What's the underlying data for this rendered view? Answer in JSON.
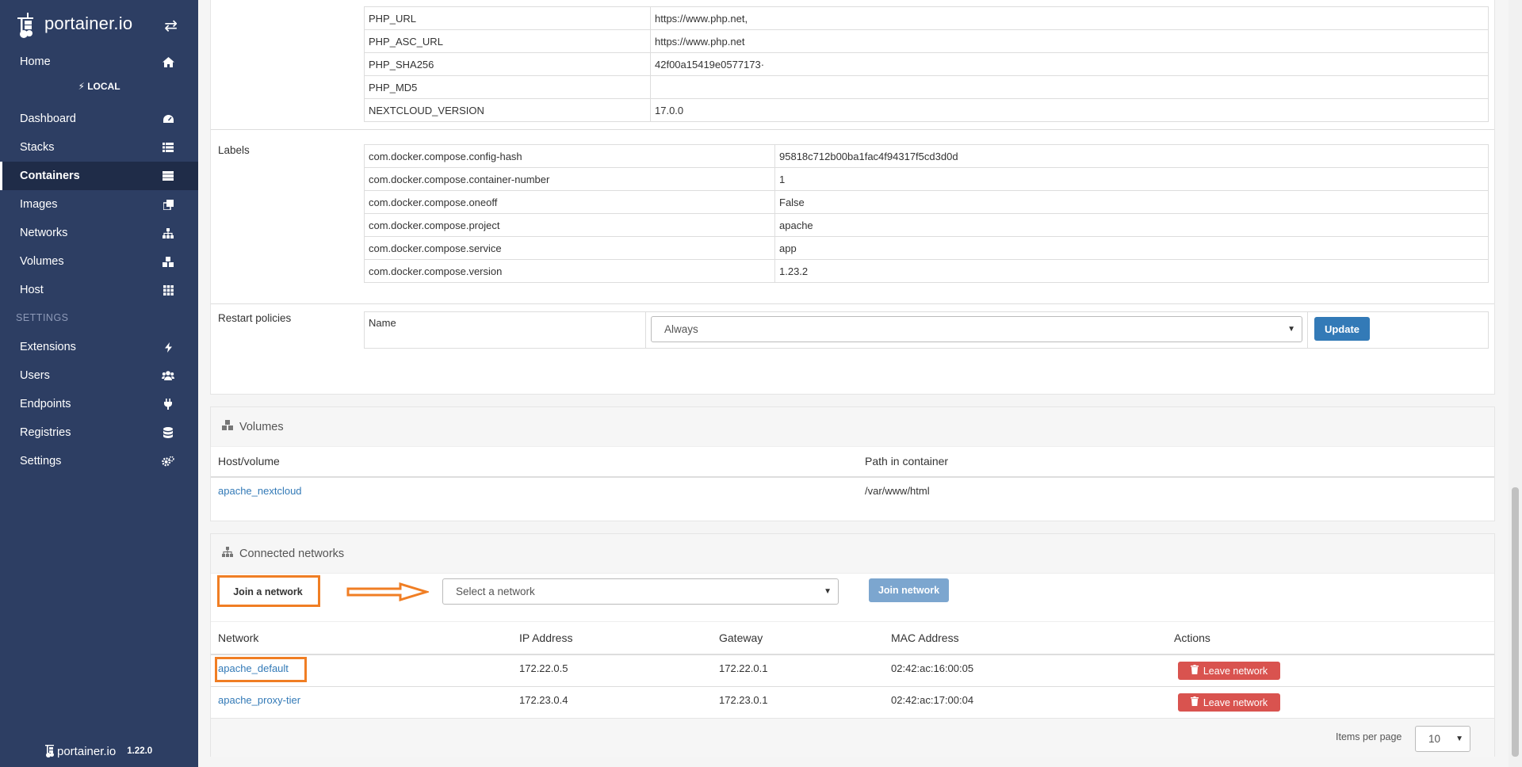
{
  "brand": {
    "name": "portainer.io",
    "version": "1.22.0"
  },
  "sidebar": {
    "home": "Home",
    "endpoint": "LOCAL",
    "items": [
      {
        "label": "Dashboard",
        "icon": "tachometer-icon"
      },
      {
        "label": "Stacks",
        "icon": "list-icon"
      },
      {
        "label": "Containers",
        "icon": "server-icon"
      },
      {
        "label": "Images",
        "icon": "clone-icon"
      },
      {
        "label": "Networks",
        "icon": "sitemap-icon"
      },
      {
        "label": "Volumes",
        "icon": "cubes-icon"
      },
      {
        "label": "Host",
        "icon": "th-icon"
      }
    ],
    "settings_header": "SETTINGS",
    "settings_items": [
      {
        "label": "Extensions",
        "icon": "bolt-icon"
      },
      {
        "label": "Users",
        "icon": "users-icon"
      },
      {
        "label": "Endpoints",
        "icon": "plug-icon"
      },
      {
        "label": "Registries",
        "icon": "database-icon"
      },
      {
        "label": "Settings",
        "icon": "cogs-icon"
      }
    ]
  },
  "env": [
    {
      "key": "PHP_URL",
      "value": "https://www.php.net,"
    },
    {
      "key": "PHP_ASC_URL",
      "value": "https://www.php.net"
    },
    {
      "key": "PHP_SHA256",
      "value": "42f00a15419e0577173·"
    },
    {
      "key": "PHP_MD5",
      "value": ""
    },
    {
      "key": "NEXTCLOUD_VERSION",
      "value": "17.0.0"
    }
  ],
  "labels": {
    "title": "Labels",
    "rows": [
      {
        "key": "com.docker.compose.config-hash",
        "value": "95818c712b00ba1fac4f94317f5cd3d0d"
      },
      {
        "key": "com.docker.compose.container-number",
        "value": "1"
      },
      {
        "key": "com.docker.compose.oneoff",
        "value": "False"
      },
      {
        "key": "com.docker.compose.project",
        "value": "apache"
      },
      {
        "key": "com.docker.compose.service",
        "value": "app"
      },
      {
        "key": "com.docker.compose.version",
        "value": "1.23.2"
      }
    ]
  },
  "restart": {
    "title": "Restart policies",
    "name_label": "Name",
    "selected": "Always",
    "update_label": "Update"
  },
  "volumes": {
    "title": "Volumes",
    "col_host": "Host/volume",
    "col_path": "Path in container",
    "rows": [
      {
        "host": "apache_nextcloud",
        "path": "/var/www/html"
      }
    ]
  },
  "networks": {
    "title": "Connected networks",
    "join_label": "Join a network",
    "select_placeholder": "Select a network",
    "join_button": "Join network",
    "columns": [
      "Network",
      "IP Address",
      "Gateway",
      "MAC Address",
      "Actions"
    ],
    "rows": [
      {
        "network": "apache_default",
        "ip": "172.22.0.5",
        "gateway": "172.22.0.1",
        "mac": "02:42:ac:16:00:05",
        "action": "Leave network"
      },
      {
        "network": "apache_proxy-tier",
        "ip": "172.23.0.4",
        "gateway": "172.23.0.1",
        "mac": "02:42:ac:17:00:04",
        "action": "Leave network"
      }
    ],
    "items_per_page_label": "Items per page",
    "items_per_page": "10"
  }
}
